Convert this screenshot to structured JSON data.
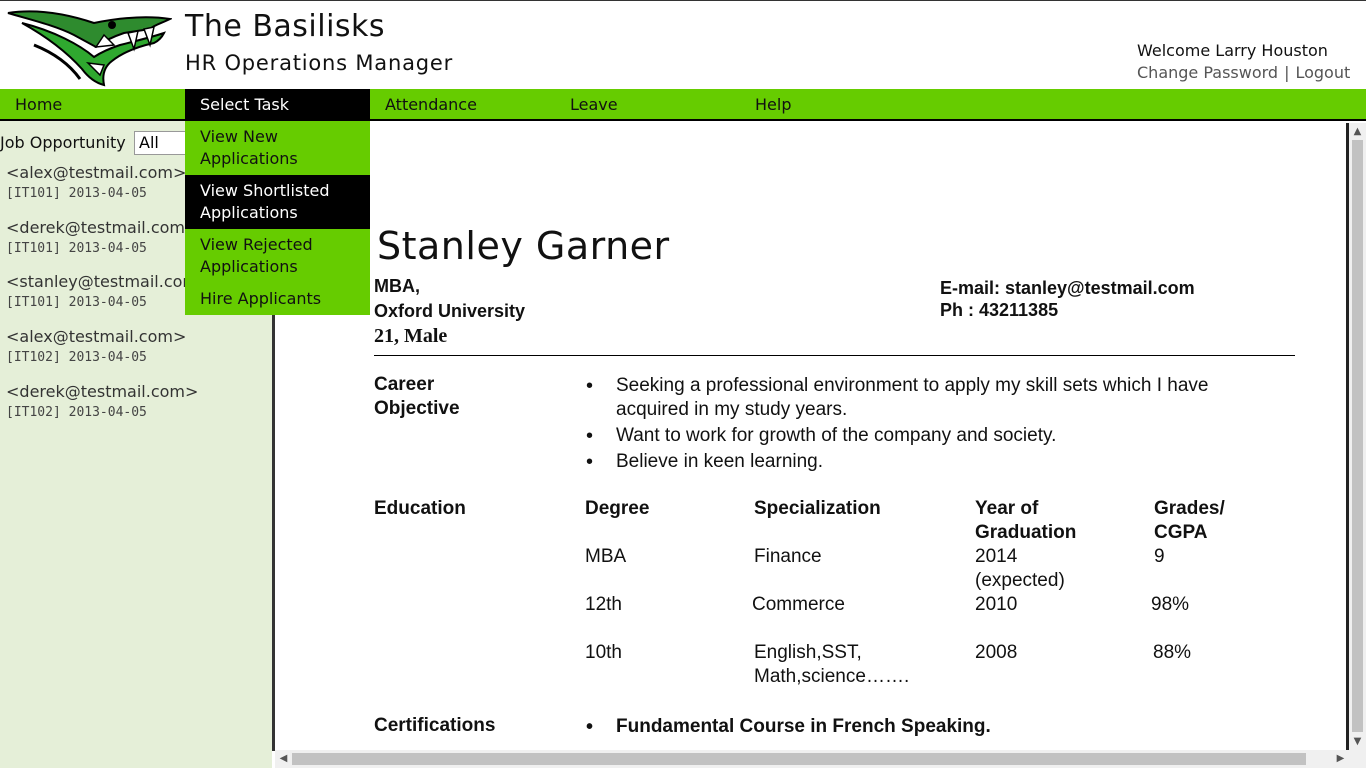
{
  "header": {
    "title": "The Basilisks",
    "subtitle": "HR Operations Manager",
    "welcome": "Welcome Larry Houston",
    "change_password": "Change Password",
    "separator": "|",
    "logout": "Logout"
  },
  "nav": {
    "home": "Home",
    "select_task": "Select Task",
    "attendance": "Attendance",
    "leave": "Leave",
    "help": "Help"
  },
  "dropdown": {
    "items": [
      {
        "label": "View New Applications"
      },
      {
        "label": "View Shortlisted Applications"
      },
      {
        "label": "View Rejected Applications"
      },
      {
        "label": "Hire Applicants"
      }
    ]
  },
  "sidebar": {
    "filter_label": "Job Opportunity",
    "filter_value": "All",
    "applications": [
      {
        "email": "<alex@testmail.com>",
        "meta": "[IT101] 2013-04-05"
      },
      {
        "email": "<derek@testmail.com>",
        "meta": "[IT101] 2013-04-05"
      },
      {
        "email": "<stanley@testmail.com>",
        "meta": "[IT101] 2013-04-05"
      },
      {
        "email": "<alex@testmail.com>",
        "meta": "[IT102] 2013-04-05"
      },
      {
        "email": "<derek@testmail.com>",
        "meta": "[IT102] 2013-04-05"
      }
    ]
  },
  "resume": {
    "name": "Stanley Garner",
    "degree": "MBA,",
    "university": "Oxford University",
    "age_gender": "21, Male",
    "email": "E-mail: stanley@testmail.com",
    "phone": "Ph : 43211385",
    "career_title_1": "Career",
    "career_title_2": "Objective",
    "career_objectives": [
      "Seeking a professional environment to apply my skill sets which I have acquired in my study years.",
      "Want to work for growth of the company and society.",
      "Believe in keen learning."
    ],
    "education_title": "Education",
    "education_headers": {
      "degree": "Degree",
      "specialization": "Specialization",
      "year_1": "Year of",
      "year_2": "Graduation",
      "grades_1": "Grades/",
      "grades_2": "CGPA"
    },
    "education_rows": [
      {
        "degree": "MBA",
        "specialization": "Finance",
        "year": "2014",
        "year_note": "(expected)",
        "grade": "9"
      },
      {
        "degree": "12th",
        "specialization": "Commerce",
        "year": "2010",
        "grade": "98%"
      },
      {
        "degree": "10th",
        "specialization": "English,SST,",
        "specialization_2": "Math,science…….",
        "year": "2008",
        "grade": "88%"
      }
    ],
    "certifications_title": "Certifications",
    "certifications": [
      "Fundamental Course in French Speaking."
    ]
  },
  "colors": {
    "nav_green": "#66cc00",
    "sidebar_bg": "#e5efd8",
    "active_black": "#000000"
  }
}
